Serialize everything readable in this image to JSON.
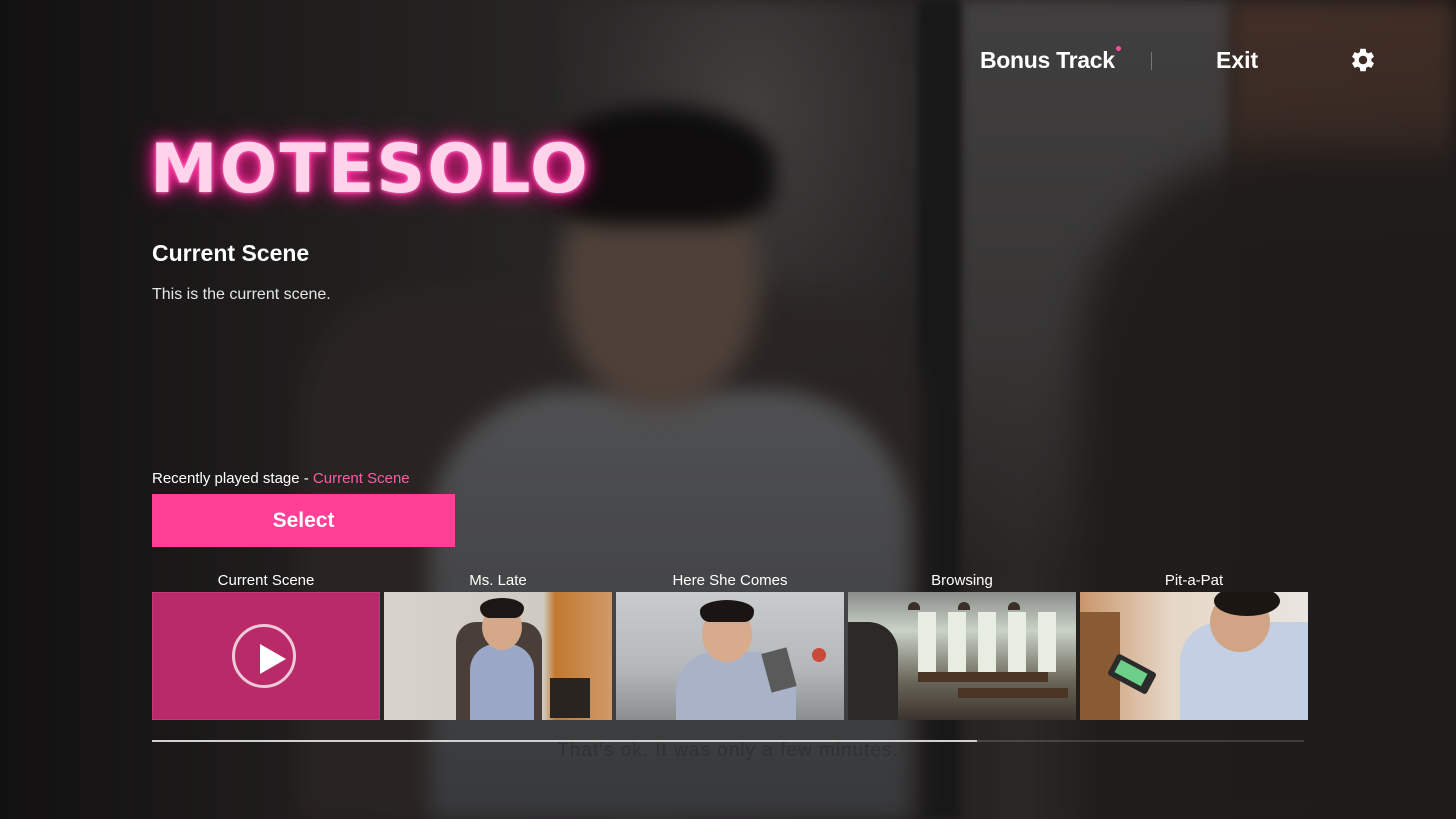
{
  "topbar": {
    "bonus_label": "Bonus Track",
    "exit_label": "Exit",
    "settings_icon": "gear-icon"
  },
  "logo": {
    "text": "MOTESOLO"
  },
  "scene": {
    "title": "Current Scene",
    "description": "This is the current scene."
  },
  "recent": {
    "prefix": "Recently played stage - ",
    "stage": "Current Scene"
  },
  "select_label": "Select",
  "thumbnails": [
    {
      "label": "Current Scene"
    },
    {
      "label": "Ms. Late"
    },
    {
      "label": "Here She Comes"
    },
    {
      "label": "Browsing"
    },
    {
      "label": "Pit-a-Pat"
    }
  ],
  "progress": {
    "fraction": 0.716
  },
  "subtitle": "That's ok. It was only a few minutes.",
  "colors": {
    "accent": "#ff4096",
    "accent_text": "#ff5aa8",
    "play_tile": "#b82a68"
  }
}
